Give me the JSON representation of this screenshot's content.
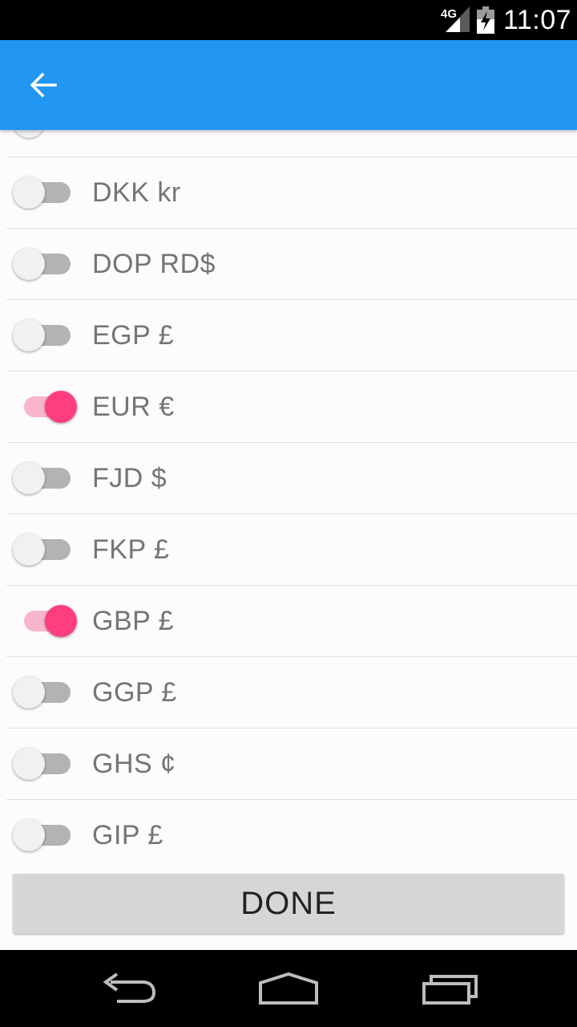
{
  "status_bar": {
    "network": "4G",
    "time": "11:07"
  },
  "app_bar": {
    "back_icon": "arrow-left-icon"
  },
  "currencies": [
    {
      "label": "DKK kr",
      "enabled": false
    },
    {
      "label": "DOP RD$",
      "enabled": false
    },
    {
      "label": "EGP £",
      "enabled": false
    },
    {
      "label": "EUR €",
      "enabled": true
    },
    {
      "label": "FJD $",
      "enabled": false
    },
    {
      "label": "FKP £",
      "enabled": false
    },
    {
      "label": "GBP £",
      "enabled": true
    },
    {
      "label": "GGP £",
      "enabled": false
    },
    {
      "label": "GHS ¢",
      "enabled": false
    },
    {
      "label": "GIP £",
      "enabled": false
    }
  ],
  "done_label": "DONE",
  "colors": {
    "app_bar": "#2196f3",
    "switch_on_thumb": "#ff3e7f",
    "switch_on_track": "#f9b5cc",
    "switch_off_track": "#b3b3b3"
  },
  "nav_icons": [
    "back-nav-icon",
    "home-nav-icon",
    "recents-nav-icon"
  ]
}
